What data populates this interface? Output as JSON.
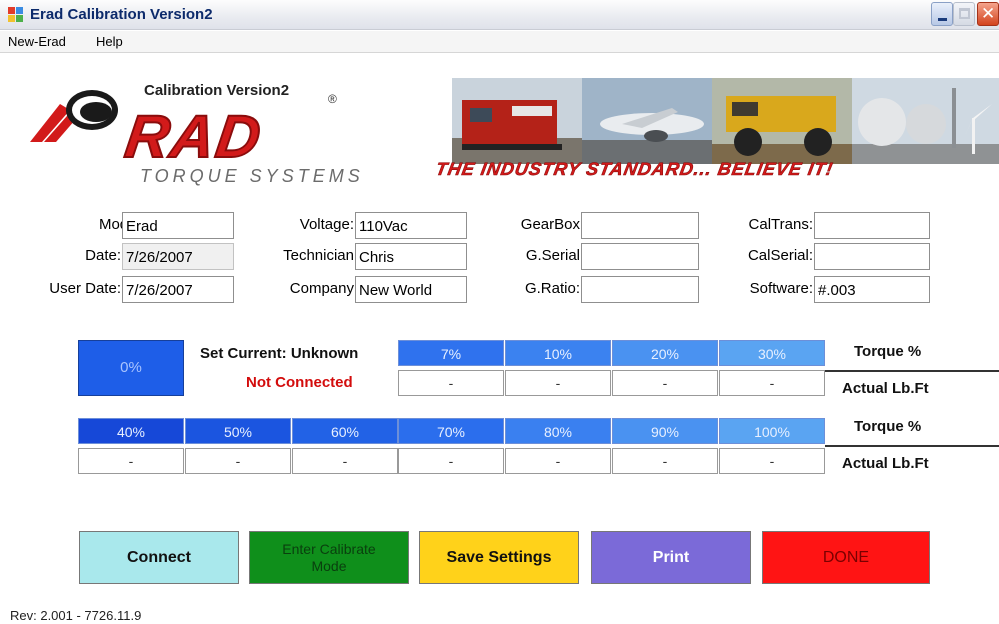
{
  "window": {
    "title": "Erad Calibration Version2"
  },
  "menu": [
    "New-Erad",
    "Help"
  ],
  "banner": {
    "subtitle": "Calibration Version2",
    "reg": "®",
    "logo_text": "RAD",
    "logo_sub": "TORQUE SYSTEMS",
    "slogan": "THE INDUSTRY STANDARD... BELIEVE IT!"
  },
  "fields": {
    "model": {
      "label": "Model:",
      "value": "Erad"
    },
    "date": {
      "label": "Date:",
      "value": "7/26/2007"
    },
    "user_date": {
      "label": "User Date:",
      "value": "7/26/2007"
    },
    "voltage": {
      "label": "Voltage:",
      "value": "110Vac"
    },
    "technician": {
      "label": "Technician",
      "value": "Chris"
    },
    "company": {
      "label": "Company",
      "value": "New World"
    },
    "gearbox": {
      "label": "GearBox",
      "value": ""
    },
    "g_serial": {
      "label": "G.Serial",
      "value": ""
    },
    "g_ratio": {
      "label": "G.Ratio:",
      "value": ""
    },
    "caltrans": {
      "label": "CalTrans:",
      "value": ""
    },
    "calserial": {
      "label": "CalSerial:",
      "value": ""
    },
    "software": {
      "label": "Software:",
      "value": "#.003"
    }
  },
  "torque": {
    "zero_label": "0%",
    "set_current": "Set Current: Unknown",
    "status": "Not Connected",
    "torque_label": "Torque %",
    "actual_label": "Actual Lb.Ft",
    "row1": [
      {
        "pct": "7%",
        "actual": "-"
      },
      {
        "pct": "10%",
        "actual": "-"
      },
      {
        "pct": "20%",
        "actual": "-"
      },
      {
        "pct": "30%",
        "actual": "-"
      }
    ],
    "row2": [
      {
        "pct": "40%",
        "actual": "-"
      },
      {
        "pct": "50%",
        "actual": "-"
      },
      {
        "pct": "60%",
        "actual": "-"
      },
      {
        "pct": "70%",
        "actual": "-"
      },
      {
        "pct": "80%",
        "actual": "-"
      },
      {
        "pct": "90%",
        "actual": "-"
      },
      {
        "pct": "100%",
        "actual": "-"
      }
    ]
  },
  "buttons": {
    "connect": "Connect",
    "calibrate": "Enter Calibrate Mode",
    "save": "Save Settings",
    "print": "Print",
    "done": "DONE"
  },
  "footer": {
    "rev": "Rev: 2.001 - 7726.11.9"
  },
  "colors": {
    "torque_blue_dark": "#1e5ee8",
    "torque_blue_light": "#5fa6f0",
    "connect": "#a9e8ec",
    "calibrate": "#0f8f1b",
    "save": "#ffd21a",
    "print": "#7b6ad8",
    "done": "#ff1414",
    "status_red": "#d30c0c"
  }
}
